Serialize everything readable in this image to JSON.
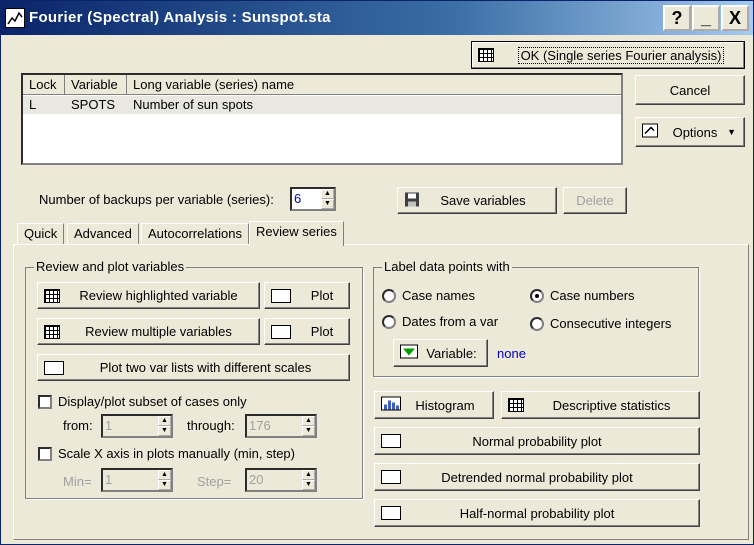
{
  "window": {
    "title": "Fourier (Spectral) Analysis : Sunspot.sta",
    "help_glyph": "?",
    "minimize_glyph": "_",
    "close_glyph": "X"
  },
  "buttons": {
    "ok": "OK (Single series Fourier analysis)",
    "cancel": "Cancel",
    "options": "Options",
    "options_arrow": "▼",
    "save_variables": "Save variables",
    "delete": "Delete"
  },
  "table": {
    "columns": [
      "Lock",
      "Variable",
      "Long variable (series) name"
    ],
    "rows": [
      [
        "L",
        "SPOTS",
        "Number of sun spots"
      ]
    ]
  },
  "backups": {
    "label": "Number of backups per variable (series):",
    "value": "6"
  },
  "tabs": [
    "Quick",
    "Advanced",
    "Autocorrelations",
    "Review series"
  ],
  "active_tab": "Review series",
  "review": {
    "group_title": "Review and plot variables",
    "review_highlighted": "Review highlighted variable",
    "plot1": "Plot",
    "review_multiple": "Review multiple variables",
    "plot2": "Plot",
    "plot_two_lists": "Plot two var lists with different scales",
    "subset_label": "Display/plot subset of cases only",
    "from_label": "from:",
    "from_value": "1",
    "through_label": "through:",
    "through_value": "176",
    "scale_label": "Scale X axis in plots manually (min, step)",
    "min_label": "Min=",
    "min_value": "1",
    "step_label": "Step=",
    "step_value": "20"
  },
  "label_points": {
    "group_title": "Label data points with",
    "case_names": "Case names",
    "case_numbers": "Case numbers",
    "dates_from_var": "Dates from a var",
    "consecutive_integers": "Consecutive integers",
    "selected": "Case numbers",
    "variable_button": "Variable:",
    "variable_value": "none"
  },
  "stats": {
    "histogram": "Histogram",
    "descriptive": "Descriptive statistics",
    "normal_prob": "Normal probability plot",
    "detrended": "Detrended normal probability plot",
    "half_normal": "Half-normal probability plot"
  },
  "colors": {
    "title_bar": "#0a246a",
    "face": "#ece9d8",
    "link_blue": "#0000c0"
  }
}
